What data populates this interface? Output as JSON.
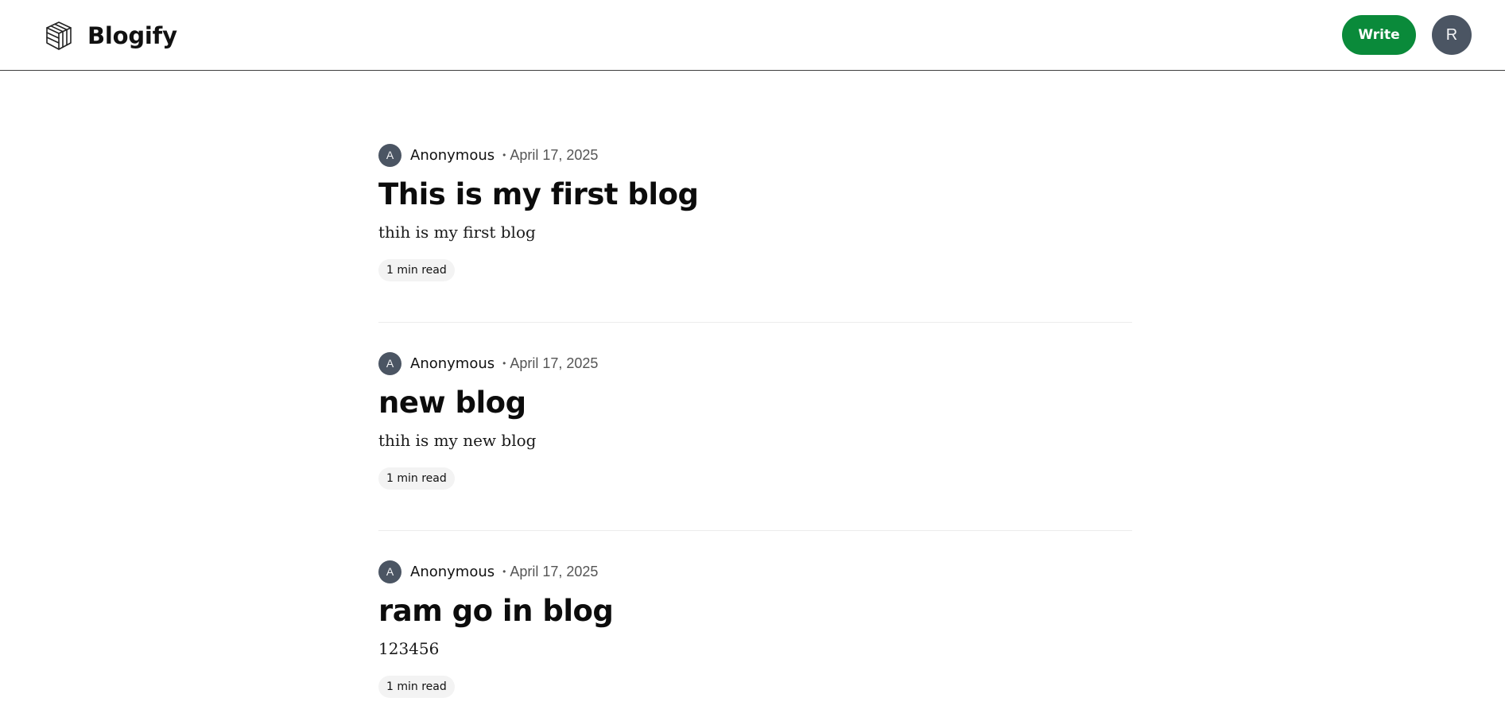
{
  "header": {
    "brand_name": "Blogify",
    "logo_icon": "cube-box-icon",
    "write_label": "Write",
    "user_initial": "R"
  },
  "colors": {
    "write_button": "#0a8a3a",
    "avatar": "#4b5563",
    "header_border": "#3f3f3f"
  },
  "posts": [
    {
      "author_initial": "A",
      "author": "Anonymous",
      "separator": "•",
      "date": "April 17, 2025",
      "title": "This is my first blog",
      "excerpt": "thih is my first blog",
      "read_time": "1 min read"
    },
    {
      "author_initial": "A",
      "author": "Anonymous",
      "separator": "•",
      "date": "April 17, 2025",
      "title": "new blog",
      "excerpt": "thih is my new blog",
      "read_time": "1 min read"
    },
    {
      "author_initial": "A",
      "author": "Anonymous",
      "separator": "•",
      "date": "April 17, 2025",
      "title": "ram go in blog",
      "excerpt": "123456",
      "read_time": "1 min read"
    }
  ]
}
